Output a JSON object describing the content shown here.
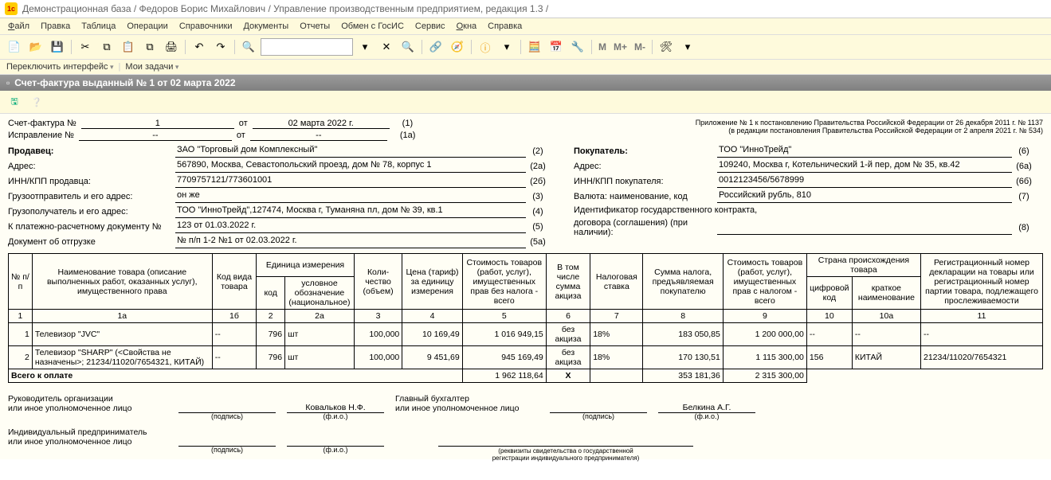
{
  "app_title": "Демонстрационная база / Федоров Борис Михайлович / Управление производственным предприятием, редакция 1.3 /",
  "menu": {
    "file": "Файл",
    "edit": "Правка",
    "table": "Таблица",
    "ops": "Операции",
    "ref": "Справочники",
    "docs": "Документы",
    "rep": "Отчеты",
    "gosis": "Обмен с ГосИС",
    "svc": "Сервис",
    "win": "Окна",
    "help": "Справка"
  },
  "subbar": {
    "switch": "Переключить интерфейс",
    "tasks": "Мои задачи"
  },
  "tab_title": "Счет-фактура выданный № 1 от 02 марта 2022",
  "topright1": "Приложение № 1 к постановлению Правительства Российской Федерации от 26 декабря 2011 г. № 1137",
  "topright2": "(в редакции постановления Правительства Российской Федерации от 2 апреля 2021 г. № 534)",
  "inv": {
    "invoice_lbl": "Счет-фактура №",
    "invoice_no": "1",
    "ot": "от",
    "invoice_date": "02 марта 2022 г.",
    "n1": "(1)",
    "fix_lbl": "Исправление №",
    "fix_no": "--",
    "fix_date": "--",
    "n1a": "(1a)"
  },
  "left": {
    "seller_lbl": "Продавец:",
    "seller": "ЗАО \"Торговый дом Комплексный\"",
    "n2": "(2)",
    "addr_lbl": "Адрес:",
    "addr": "567890, Москва, Севастопольский проезд, дом № 78, корпус 1",
    "n2a": "(2a)",
    "inn_lbl": "ИНН/КПП продавца:",
    "inn": "7709757121/773601001",
    "n2b": "(2б)",
    "shipper_lbl": "Грузоотправитель и его адрес:",
    "shipper": "он же",
    "n3": "(3)",
    "cons_lbl": "Грузополучатель и его адрес:",
    "cons": "ТОО \"ИнноТрейд\",127474, Москва г, Туманяна пл, дом № 39, кв.1",
    "n4": "(4)",
    "pay_lbl": "К платежно-расчетному документу №",
    "pay": "123 от 01.03.2022 г.",
    "n5": "(5)",
    "ship_lbl": "Документ об отгрузке",
    "ship": "№ п/п 1-2 №1 от 02.03.2022 г.",
    "n5a": "(5a)"
  },
  "right": {
    "buyer_lbl": "Покупатель:",
    "buyer": "ТОО \"ИнноТрейд\"",
    "n6": "(6)",
    "addr_lbl": "Адрес:",
    "addr": "109240, Москва г, Котельнический 1-й пер, дом № 35, кв.42",
    "n6a": "(6a)",
    "inn_lbl": "ИНН/КПП покупателя:",
    "inn": "0012123456/5678999",
    "n6b": "(6б)",
    "cur_lbl": "Валюта: наименование, код",
    "cur": "Российский рубль, 810",
    "n7": "(7)",
    "gos_lbl1": "Идентификатор государственного контракта,",
    "gos_lbl2": "договора (соглашения) (при наличии):",
    "n8": "(8)"
  },
  "thead": {
    "c1": "№ п/п",
    "c1a": "Наименование товара (описание выполненных работ, оказанных услуг), имущественного права",
    "c1b": "Код вида товара",
    "c2": "Единица измерения",
    "c2a": "код",
    "c2b": "условное обозначение (национальное)",
    "c3": "Коли-чество (объем)",
    "c4": "Цена (тариф) за единицу измерения",
    "c5": "Стоимость товаров (работ, услуг), имущественных прав без налога - всего",
    "c6": "В том числе сумма акциза",
    "c7": "Налоговая ставка",
    "c8": "Сумма налога, предъявляемая покупателю",
    "c9": "Стоимость товаров (работ, услуг), имущественных прав с налогом - всего",
    "c10": "Страна происхождения товара",
    "c10a": "цифровой код",
    "c10b": "краткое наименование",
    "c11": "Регистрационный номер декларации на товары или регистрационный номер партии товара, подлежащего прослеживаемости"
  },
  "numrow": {
    "c1": "1",
    "c1a": "1a",
    "c1b": "1б",
    "c2": "2",
    "c2a": "2a",
    "c3": "3",
    "c4": "4",
    "c5": "5",
    "c6": "6",
    "c7": "7",
    "c8": "8",
    "c9": "9",
    "c10": "10",
    "c10a": "10a",
    "c11": "11"
  },
  "rows": [
    {
      "n": "1",
      "name": "Телевизор \"JVC\"",
      "kind": "--",
      "ucode": "796",
      "uname": "шт",
      "qty": "100,000",
      "price": "10 169,49",
      "sum_no_tax": "1 016 949,15",
      "excise": "без акциза",
      "rate": "18%",
      "tax": "183 050,85",
      "sum_tax": "1 200 000,00",
      "ccode": "--",
      "cname": "--",
      "decl": "--"
    },
    {
      "n": "2",
      "name": "Телевизор \"SHARP\" (<Свойства не назначены>; 21234/11020/7654321, КИТАЙ)",
      "kind": "--",
      "ucode": "796",
      "uname": "шт",
      "qty": "100,000",
      "price": "9 451,69",
      "sum_no_tax": "945 169,49",
      "excise": "без акциза",
      "rate": "18%",
      "tax": "170 130,51",
      "sum_tax": "1 115 300,00",
      "ccode": "156",
      "cname": "КИТАЙ",
      "decl": "21234/11020/7654321"
    }
  ],
  "total": {
    "lbl": "Всего к оплате",
    "sum_no_tax": "1 962 118,64",
    "x": "X",
    "tax": "353 181,36",
    "sum_tax": "2 315 300,00"
  },
  "sig": {
    "head_lbl": "Руководитель организации\nили иное уполномоченное лицо",
    "head_name": "Ковальков Н.Ф.",
    "acc_lbl": "Главный бухгалтер\nили иное уполномоченное лицо",
    "acc_name": "Белкина А.Г.",
    "ip_lbl": "Индивидуальный предприниматель\nили иное уполномоченное лицо",
    "sub_sign": "(подпись)",
    "sub_fio": "(ф.и.о.)",
    "rek": "(реквизиты свидетельства о государственной\nрегистрации индивидуального предпринимателя)"
  }
}
